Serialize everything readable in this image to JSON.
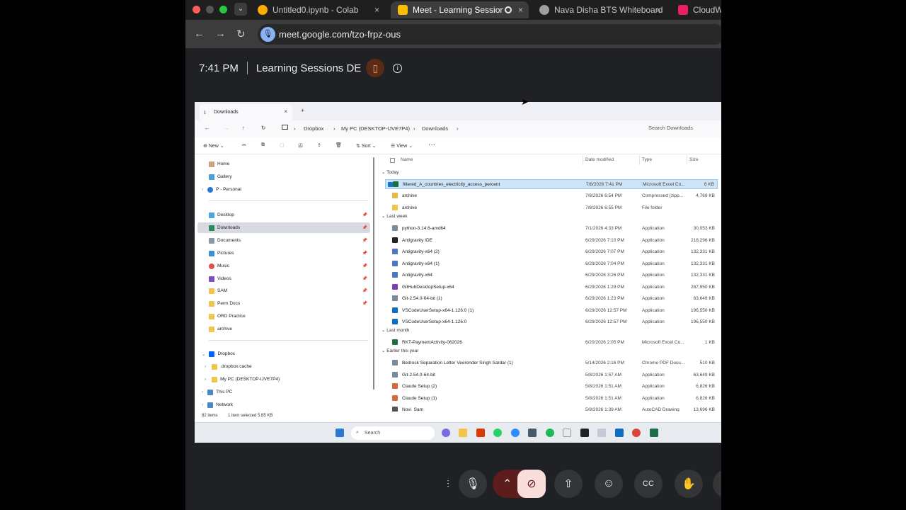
{
  "browser": {
    "tabs": [
      {
        "title": "Untitled0.ipynb - Colab",
        "icon_color": "#f9ab00"
      },
      {
        "title": "Meet - Learning Sessions",
        "icon_color": "#fbbc04"
      },
      {
        "title": "Nava Disha BTS Whiteboard",
        "icon_color": "#9aa0a6"
      },
      {
        "title": "CloudWa",
        "icon_color": "#e91e63"
      }
    ],
    "url": "meet.google.com/tzo-frpz-ous",
    "close_glyph": "×"
  },
  "meet": {
    "time": "7:41 PM",
    "meeting_name": "Learning Sessions DE"
  },
  "explorer": {
    "tab_title": "Downloads",
    "breadcrumb": [
      "Dropbox",
      "My PC (DESKTOP-IJVE7P4)",
      "Downloads"
    ],
    "search_placeholder": "Search Downloads",
    "toolbar": {
      "new": "New",
      "sort": "Sort",
      "view": "View"
    },
    "nav": {
      "home": "Home",
      "gallery": "Gallery",
      "personal": "P - Personal",
      "desktop": "Desktop",
      "downloads": "Downloads",
      "documents": "Documents",
      "pictures": "Pictures",
      "music": "Music",
      "videos": "Videos",
      "sam": "SAM",
      "perm_docs": "Perm Docs",
      "ord_practice": "ORD Practice",
      "archive": "archive",
      "dropbox": "Dropbox",
      "dropbox_cache": ".dropbox.cache",
      "my_pc": "My PC (DESKTOP-IJVE7P4)",
      "this_pc": "This PC",
      "network": "Network"
    },
    "columns": {
      "name": "Name",
      "date": "Date modified",
      "type": "Type",
      "size": "Size"
    },
    "groups": {
      "today": "Today",
      "last_week": "Last week",
      "last_month": "Last month",
      "earlier": "Earlier this year"
    },
    "files": [
      {
        "name": "filtered_A_countries_electricity_access_percent",
        "date": "7/8/2026 7:41 PM",
        "type": "Microsoft Excel Co...",
        "size": "6 KB",
        "color": "#1d7044"
      },
      {
        "name": "archive",
        "date": "7/8/2026 6:54 PM",
        "type": "Compressed (zipp...",
        "size": "4,769 KB",
        "color": "#e8b84a"
      },
      {
        "name": "archive",
        "date": "7/8/2026 6:55 PM",
        "type": "File folder",
        "size": "",
        "color": "#f0c54a"
      },
      {
        "name": "python-3.14.6-amd64",
        "date": "7/1/2026 4:33 PM",
        "type": "Application",
        "size": "30,053 KB",
        "color": "#7a8aa0"
      },
      {
        "name": "Antigravity IDE",
        "date": "6/29/2026 7:10 PM",
        "type": "Application",
        "size": "218,296 KB",
        "color": "#222222"
      },
      {
        "name": "Antigravity-x64 (2)",
        "date": "6/29/2026 7:07 PM",
        "type": "Application",
        "size": "132,331 KB",
        "color": "#4a78c2"
      },
      {
        "name": "Antigravity-x64 (1)",
        "date": "6/29/2026 7:04 PM",
        "type": "Application",
        "size": "132,331 KB",
        "color": "#4a78c2"
      },
      {
        "name": "Antigravity-x64",
        "date": "6/29/2026 3:26 PM",
        "type": "Application",
        "size": "132,331 KB",
        "color": "#4a78c2"
      },
      {
        "name": "GitHubDesktopSetup-x64",
        "date": "6/29/2026 1:29 PM",
        "type": "Application",
        "size": "287,950 KB",
        "color": "#7b3fb2"
      },
      {
        "name": "Git-2.54.0-64-bit (1)",
        "date": "6/29/2026 1:23 PM",
        "type": "Application",
        "size": "63,649 KB",
        "color": "#7a8aa0"
      },
      {
        "name": "VSCodeUserSetup-x64-1.126.0 (1)",
        "date": "6/29/2026 12:57 PM",
        "type": "Application",
        "size": "196,550 KB",
        "color": "#0e6fc0"
      },
      {
        "name": "VSCodeUserSetup-x64-1.126.0",
        "date": "6/29/2026 12:57 PM",
        "type": "Application",
        "size": "196,550 KB",
        "color": "#0e6fc0"
      },
      {
        "name": "RKT-PaymentActivity-062026",
        "date": "6/20/2026 2:05 PM",
        "type": "Microsoft Excel Co...",
        "size": "1 KB",
        "color": "#1d7044"
      },
      {
        "name": "Bedrock Separation Letter Veerender Singh Sardar (1)",
        "date": "5/14/2026 2:16 PM",
        "type": "Chrome PDF Docu...",
        "size": "510 KB",
        "color": "#7a8aa0"
      },
      {
        "name": "Git-2.54.0-64-bit",
        "date": "5/8/2026 1:57 AM",
        "type": "Application",
        "size": "63,649 KB",
        "color": "#7a8aa0"
      },
      {
        "name": "Claude Setup (2)",
        "date": "5/8/2026 1:51 AM",
        "type": "Application",
        "size": "6,826 KB",
        "color": "#d46a3a"
      },
      {
        "name": "Claude Setup (1)",
        "date": "5/8/2026 1:51 AM",
        "type": "Application",
        "size": "6,826 KB",
        "color": "#d46a3a"
      },
      {
        "name": "Novi_Sam",
        "date": "5/8/2026 1:39 AM",
        "type": "AutoCAD Drawing",
        "size": "13,696 KB",
        "color": "#555555"
      }
    ],
    "status": {
      "count": "82 items",
      "selected": "1 item selected  5.85 KB"
    }
  },
  "taskbar": {
    "search": "Search"
  }
}
